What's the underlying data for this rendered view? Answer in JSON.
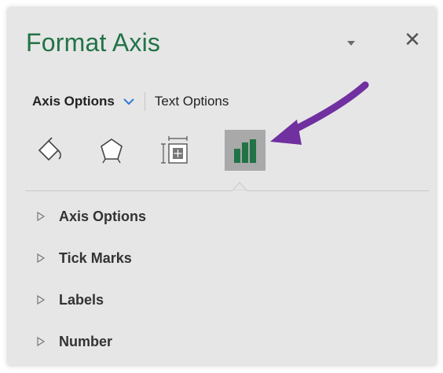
{
  "panel": {
    "title": "Format Axis",
    "close_glyph": "✕",
    "dropdown_icon": "caret-down-icon"
  },
  "tabs": {
    "axis_options": "Axis Options",
    "text_options": "Text Options"
  },
  "icons": [
    {
      "name": "fill-line-icon",
      "selected": false
    },
    {
      "name": "effects-icon",
      "selected": false
    },
    {
      "name": "size-properties-icon",
      "selected": false
    },
    {
      "name": "axis-options-icon",
      "selected": true
    }
  ],
  "sections": [
    {
      "label": "Axis Options"
    },
    {
      "label": "Tick Marks"
    },
    {
      "label": "Labels"
    },
    {
      "label": "Number"
    }
  ],
  "colors": {
    "title": "#217346",
    "chart_icon": "#217346",
    "selected_icon_bg": "#a9a9a9",
    "panel_bg": "#e6e6e6",
    "annotation_arrow": "#7030a0"
  }
}
